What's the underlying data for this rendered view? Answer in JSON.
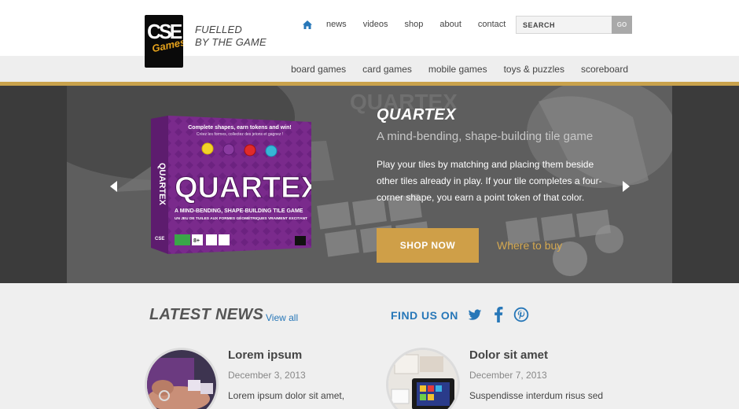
{
  "brand": {
    "logo_top": "CSE",
    "logo_bottom": "Games",
    "tagline_line1": "FUELLED",
    "tagline_line2": "BY THE GAME"
  },
  "nav": {
    "home_icon": "home-icon",
    "items": [
      "news",
      "videos",
      "shop",
      "about",
      "contact"
    ]
  },
  "search": {
    "placeholder": "SEARCH",
    "button": "GO"
  },
  "categories": [
    "board games",
    "card games",
    "mobile games",
    "toys & puzzles",
    "scoreboard"
  ],
  "hero": {
    "title": "QUARTEX",
    "subtitle": "A mind-bending, shape-building tile game",
    "description": "Play your tiles by matching and placing them beside other tiles already in play. If your tile completes a four-corner shape, you earn a point token of that color.",
    "cta": "SHOP NOW",
    "secondary_link": "Where to buy",
    "box": {
      "tagline1": "Complete shapes, earn tokens and win!",
      "tagline2": "Créez les formes, collectez des jetons et gagnez !",
      "name": "QUARTEX",
      "strap1": "A MIND-BENDING, SHAPE-BUILDING TILE GAME",
      "strap2": "UN JEU DE TUILES AUX FORMES GÉOMÉTRIQUES VRAIMENT EXCITANT",
      "age": "8+",
      "side_name": "QUARTEX",
      "side_brand": "CSE"
    }
  },
  "news": {
    "title": "LATEST NEWS",
    "view_all": "View all",
    "articles": [
      {
        "title": "Lorem ipsum",
        "date": "December 3, 2013",
        "excerpt": "Lorem ipsum dolor sit amet,"
      },
      {
        "title": "Dolor sit amet",
        "date": "December 7, 2013",
        "excerpt": "Suspendisse interdum risus sed"
      }
    ]
  },
  "social": {
    "label": "FIND US ON",
    "icons": [
      "twitter-icon",
      "facebook-icon",
      "pinterest-icon"
    ]
  },
  "colors": {
    "accent_gold": "#c9a24c",
    "cta_gold": "#cf9f48",
    "link_blue": "#2777b8",
    "box_purple": "#7a2a8c"
  }
}
